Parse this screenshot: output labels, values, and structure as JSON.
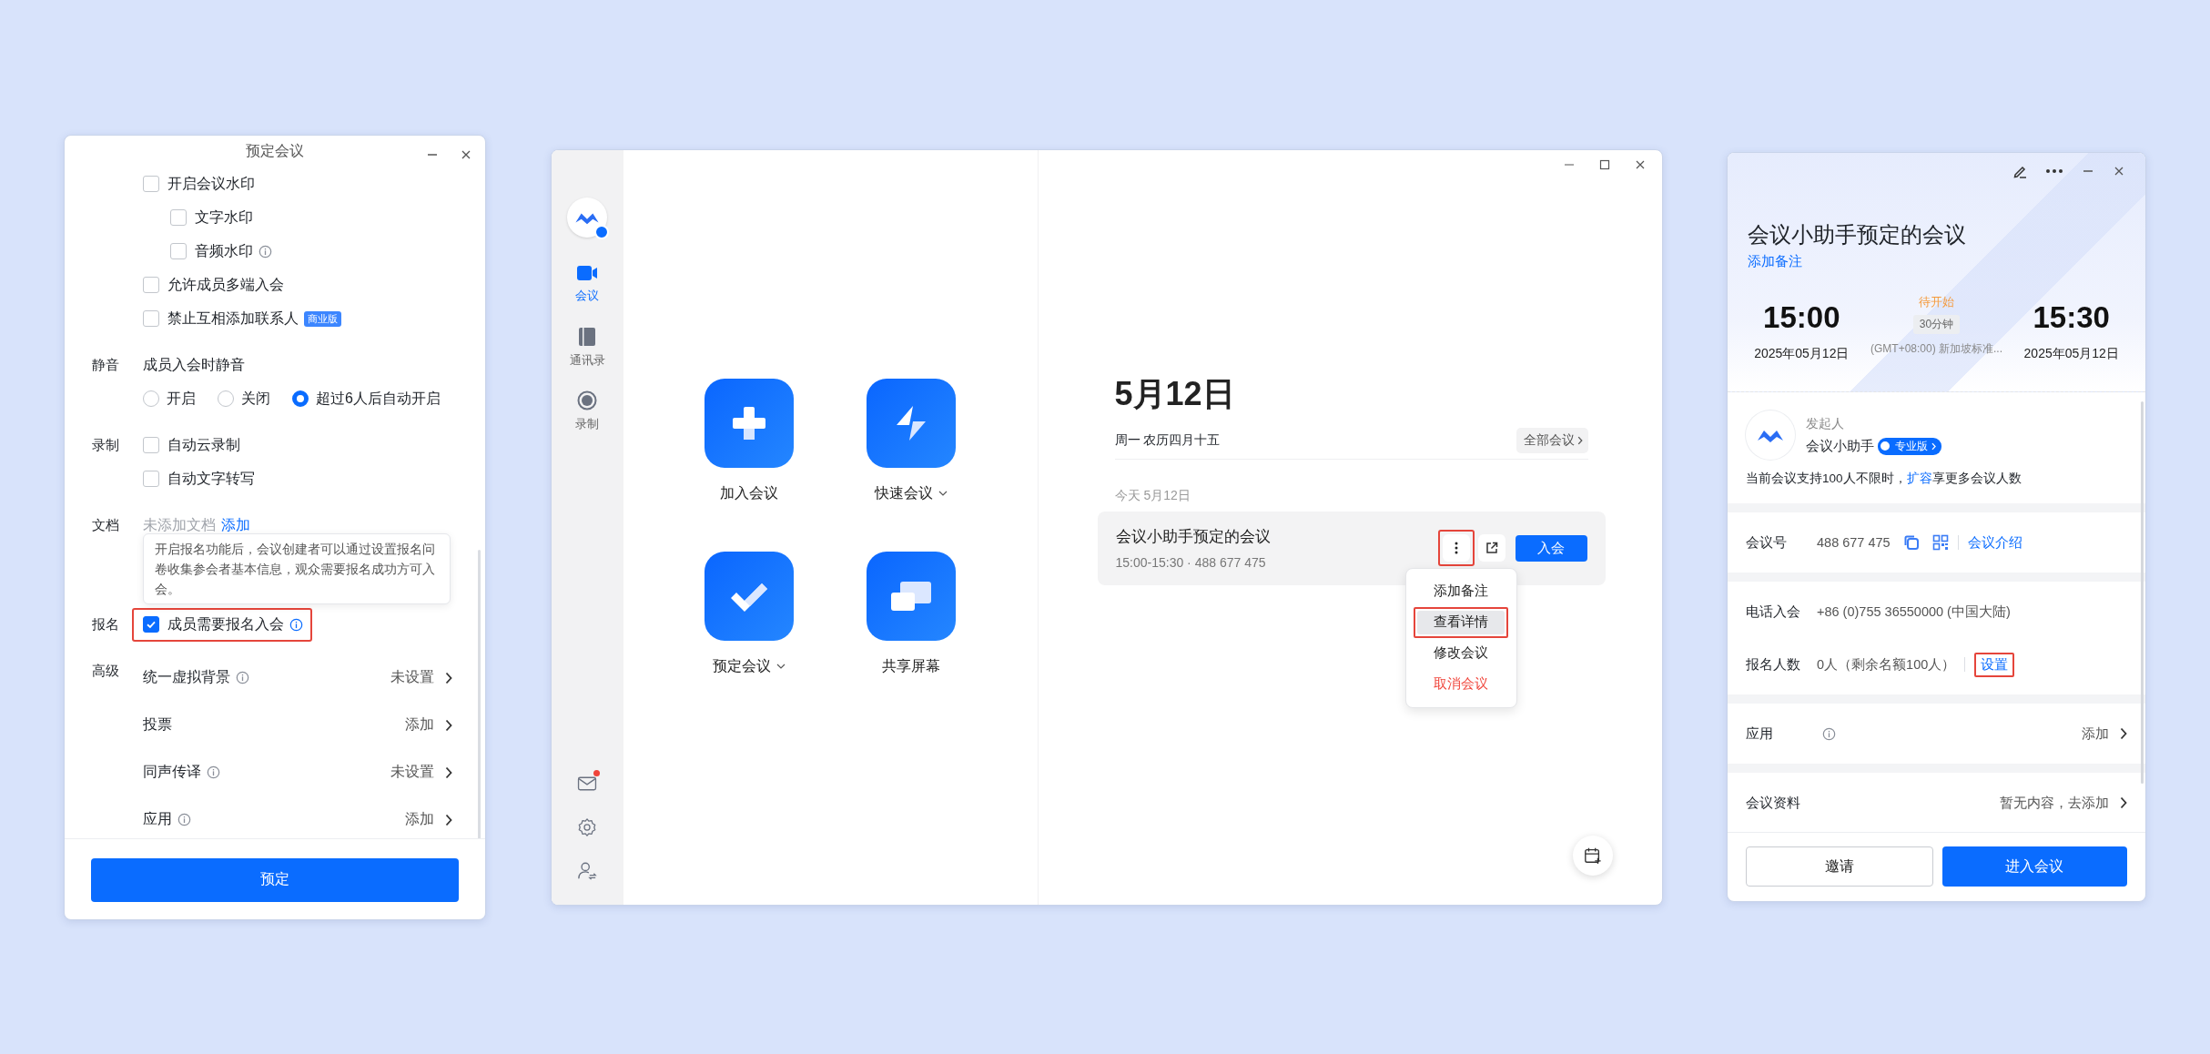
{
  "booking_window": {
    "title": "预定会议",
    "sections": [
      {
        "items": [
          {
            "kind": "checkbox",
            "label": "开启会议水印",
            "checked": false,
            "children": [
              {
                "kind": "checkbox",
                "label": "文字水印",
                "checked": false
              },
              {
                "kind": "checkbox",
                "label": "音频水印",
                "checked": false,
                "info": true
              }
            ]
          },
          {
            "kind": "checkbox",
            "label": "允许成员多端入会",
            "checked": false
          },
          {
            "kind": "checkbox",
            "label": "禁止互相添加联系人",
            "checked": false,
            "badge": "商业版"
          }
        ]
      },
      {
        "label": "静音",
        "items": [
          {
            "kind": "text",
            "text": "成员入会时静音"
          },
          {
            "kind": "radios",
            "options": [
              {
                "label": "开启",
                "selected": false
              },
              {
                "label": "关闭",
                "selected": false
              },
              {
                "label": "超过6人后自动开启",
                "selected": true
              }
            ]
          }
        ]
      },
      {
        "label": "录制",
        "items": [
          {
            "kind": "checkbox",
            "label": "自动云录制",
            "checked": false
          },
          {
            "kind": "checkbox",
            "label": "自动文字转写",
            "checked": false
          }
        ]
      },
      {
        "label": "文档",
        "items": [
          {
            "kind": "empty",
            "text": "未添加文档",
            "link": "添加"
          }
        ]
      },
      {
        "label": "报名",
        "items": [
          {
            "kind": "checkbox",
            "label": "成员需要报名入会",
            "checked": true,
            "info": true,
            "highlighted": true,
            "tooltip": "开启报名功能后，会议创建者可以通过设置报名问卷收集参会者基本信息，观众需要报名成功方可入会。"
          }
        ]
      },
      {
        "label": "高级",
        "items": [
          {
            "kind": "setting",
            "label": "统一虚拟背景",
            "info": true,
            "value": "未设置"
          },
          {
            "kind": "setting",
            "label": "投票",
            "value": "添加"
          },
          {
            "kind": "setting",
            "label": "同声传译",
            "info": true,
            "value": "未设置"
          },
          {
            "kind": "setting",
            "label": "应用",
            "info": true,
            "value": "添加"
          }
        ]
      }
    ],
    "submit_button": "预定"
  },
  "main_window": {
    "sidebar": {
      "nav": [
        {
          "label": "会议",
          "kind": "video",
          "selected": true
        },
        {
          "label": "通讯录",
          "kind": "contacts",
          "selected": false
        },
        {
          "label": "录制",
          "kind": "record",
          "selected": false
        }
      ],
      "bottom_icons": [
        {
          "kind": "mail",
          "unread": true
        },
        {
          "kind": "settings",
          "unread": false
        },
        {
          "kind": "account",
          "unread": false
        }
      ]
    },
    "actions": [
      {
        "label": "加入会议",
        "kind": "join",
        "dropdown": false
      },
      {
        "label": "快速会议",
        "kind": "instant",
        "dropdown": true
      },
      {
        "label": "预定会议",
        "kind": "schedule",
        "dropdown": true
      },
      {
        "label": "共享屏幕",
        "kind": "share",
        "dropdown": false
      }
    ],
    "date_heading": "5月12日",
    "date_subtitle": "周一 农历四月十五",
    "all_meetings_button": "全部会议",
    "group_label": "今天 5月12日",
    "meetings": [
      {
        "title": "会议小助手预定的会议",
        "subtitle": "15:00-15:30 · 488 677 475",
        "join_button": "入会",
        "more_highlighted": true,
        "menu": [
          {
            "label": "添加备注",
            "selected": false,
            "highlighted": false,
            "danger": false
          },
          {
            "label": "查看详情",
            "selected": true,
            "highlighted": true,
            "danger": false
          },
          {
            "label": "修改会议",
            "selected": false,
            "highlighted": false,
            "danger": false
          },
          {
            "label": "取消会议",
            "selected": false,
            "highlighted": false,
            "danger": true
          }
        ]
      }
    ]
  },
  "detail_window": {
    "title": "会议小助手预定的会议",
    "add_note": "添加备注",
    "start": {
      "time": "15:00",
      "date": "2025年05月12日"
    },
    "status": "待开始",
    "duration": "30分钟",
    "timezone": "(GMT+08:00) 新加坡标准...",
    "end": {
      "time": "15:30",
      "date": "2025年05月12日"
    },
    "host": {
      "label": "发起人",
      "name": "会议小助手",
      "badge": "专业版"
    },
    "notice": {
      "before": "当前会议支持100人不限时，",
      "link": "扩容",
      "after": "享更多会议人数"
    },
    "groups": [
      {
        "rows": [
          {
            "kind": "id",
            "label": "会议号",
            "value": "488 677 475",
            "link": "会议介绍"
          }
        ]
      },
      {
        "rows": [
          {
            "kind": "text",
            "label": "电话入会",
            "value": "+86 (0)755 36550000 (中国大陆)"
          },
          {
            "kind": "text",
            "label": "报名人数",
            "value": "0人（剩余名额100人）",
            "link": "设置",
            "link_highlighted": true
          }
        ]
      },
      {
        "rows": [
          {
            "kind": "nav",
            "label": "应用",
            "info": true,
            "value": "添加"
          }
        ]
      },
      {
        "rows": [
          {
            "kind": "nav",
            "label": "会议资料",
            "value": "暂无内容，去添加"
          }
        ]
      }
    ],
    "buttons": [
      {
        "label": "邀请",
        "primary": false
      },
      {
        "label": "进入会议",
        "primary": true
      }
    ]
  }
}
